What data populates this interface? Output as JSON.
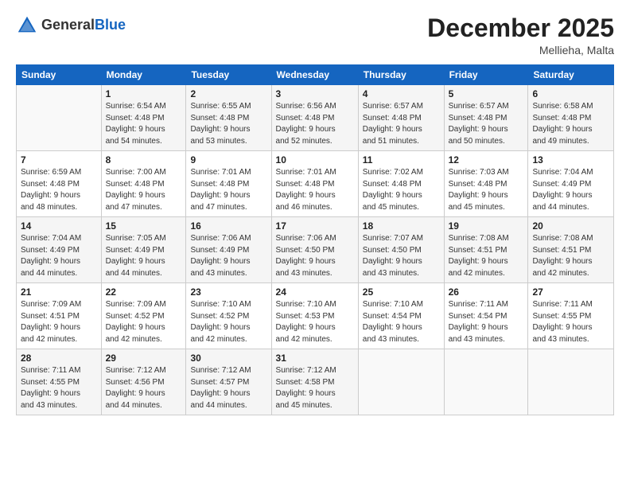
{
  "header": {
    "logo_general": "General",
    "logo_blue": "Blue",
    "month": "December 2025",
    "location": "Mellieha, Malta"
  },
  "weekdays": [
    "Sunday",
    "Monday",
    "Tuesday",
    "Wednesday",
    "Thursday",
    "Friday",
    "Saturday"
  ],
  "weeks": [
    [
      {
        "day": "",
        "info": ""
      },
      {
        "day": "1",
        "info": "Sunrise: 6:54 AM\nSunset: 4:48 PM\nDaylight: 9 hours\nand 54 minutes."
      },
      {
        "day": "2",
        "info": "Sunrise: 6:55 AM\nSunset: 4:48 PM\nDaylight: 9 hours\nand 53 minutes."
      },
      {
        "day": "3",
        "info": "Sunrise: 6:56 AM\nSunset: 4:48 PM\nDaylight: 9 hours\nand 52 minutes."
      },
      {
        "day": "4",
        "info": "Sunrise: 6:57 AM\nSunset: 4:48 PM\nDaylight: 9 hours\nand 51 minutes."
      },
      {
        "day": "5",
        "info": "Sunrise: 6:57 AM\nSunset: 4:48 PM\nDaylight: 9 hours\nand 50 minutes."
      },
      {
        "day": "6",
        "info": "Sunrise: 6:58 AM\nSunset: 4:48 PM\nDaylight: 9 hours\nand 49 minutes."
      }
    ],
    [
      {
        "day": "7",
        "info": "Sunrise: 6:59 AM\nSunset: 4:48 PM\nDaylight: 9 hours\nand 48 minutes."
      },
      {
        "day": "8",
        "info": "Sunrise: 7:00 AM\nSunset: 4:48 PM\nDaylight: 9 hours\nand 47 minutes."
      },
      {
        "day": "9",
        "info": "Sunrise: 7:01 AM\nSunset: 4:48 PM\nDaylight: 9 hours\nand 47 minutes."
      },
      {
        "day": "10",
        "info": "Sunrise: 7:01 AM\nSunset: 4:48 PM\nDaylight: 9 hours\nand 46 minutes."
      },
      {
        "day": "11",
        "info": "Sunrise: 7:02 AM\nSunset: 4:48 PM\nDaylight: 9 hours\nand 45 minutes."
      },
      {
        "day": "12",
        "info": "Sunrise: 7:03 AM\nSunset: 4:48 PM\nDaylight: 9 hours\nand 45 minutes."
      },
      {
        "day": "13",
        "info": "Sunrise: 7:04 AM\nSunset: 4:49 PM\nDaylight: 9 hours\nand 44 minutes."
      }
    ],
    [
      {
        "day": "14",
        "info": "Sunrise: 7:04 AM\nSunset: 4:49 PM\nDaylight: 9 hours\nand 44 minutes."
      },
      {
        "day": "15",
        "info": "Sunrise: 7:05 AM\nSunset: 4:49 PM\nDaylight: 9 hours\nand 44 minutes."
      },
      {
        "day": "16",
        "info": "Sunrise: 7:06 AM\nSunset: 4:49 PM\nDaylight: 9 hours\nand 43 minutes."
      },
      {
        "day": "17",
        "info": "Sunrise: 7:06 AM\nSunset: 4:50 PM\nDaylight: 9 hours\nand 43 minutes."
      },
      {
        "day": "18",
        "info": "Sunrise: 7:07 AM\nSunset: 4:50 PM\nDaylight: 9 hours\nand 43 minutes."
      },
      {
        "day": "19",
        "info": "Sunrise: 7:08 AM\nSunset: 4:51 PM\nDaylight: 9 hours\nand 42 minutes."
      },
      {
        "day": "20",
        "info": "Sunrise: 7:08 AM\nSunset: 4:51 PM\nDaylight: 9 hours\nand 42 minutes."
      }
    ],
    [
      {
        "day": "21",
        "info": "Sunrise: 7:09 AM\nSunset: 4:51 PM\nDaylight: 9 hours\nand 42 minutes."
      },
      {
        "day": "22",
        "info": "Sunrise: 7:09 AM\nSunset: 4:52 PM\nDaylight: 9 hours\nand 42 minutes."
      },
      {
        "day": "23",
        "info": "Sunrise: 7:10 AM\nSunset: 4:52 PM\nDaylight: 9 hours\nand 42 minutes."
      },
      {
        "day": "24",
        "info": "Sunrise: 7:10 AM\nSunset: 4:53 PM\nDaylight: 9 hours\nand 42 minutes."
      },
      {
        "day": "25",
        "info": "Sunrise: 7:10 AM\nSunset: 4:54 PM\nDaylight: 9 hours\nand 43 minutes."
      },
      {
        "day": "26",
        "info": "Sunrise: 7:11 AM\nSunset: 4:54 PM\nDaylight: 9 hours\nand 43 minutes."
      },
      {
        "day": "27",
        "info": "Sunrise: 7:11 AM\nSunset: 4:55 PM\nDaylight: 9 hours\nand 43 minutes."
      }
    ],
    [
      {
        "day": "28",
        "info": "Sunrise: 7:11 AM\nSunset: 4:55 PM\nDaylight: 9 hours\nand 43 minutes."
      },
      {
        "day": "29",
        "info": "Sunrise: 7:12 AM\nSunset: 4:56 PM\nDaylight: 9 hours\nand 44 minutes."
      },
      {
        "day": "30",
        "info": "Sunrise: 7:12 AM\nSunset: 4:57 PM\nDaylight: 9 hours\nand 44 minutes."
      },
      {
        "day": "31",
        "info": "Sunrise: 7:12 AM\nSunset: 4:58 PM\nDaylight: 9 hours\nand 45 minutes."
      },
      {
        "day": "",
        "info": ""
      },
      {
        "day": "",
        "info": ""
      },
      {
        "day": "",
        "info": ""
      }
    ]
  ]
}
